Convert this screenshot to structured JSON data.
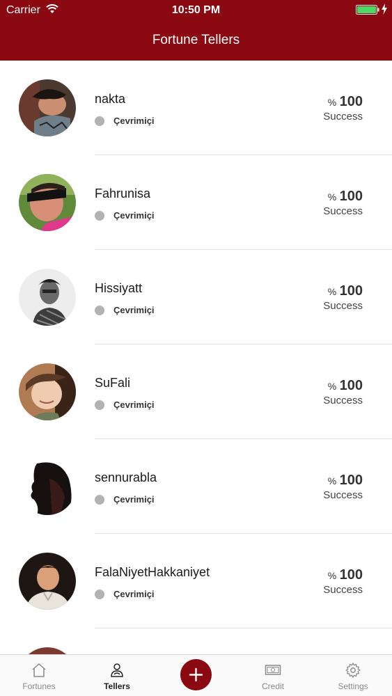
{
  "status_bar": {
    "carrier": "Carrier",
    "time": "10:50 PM",
    "battery_color": "#4cd964"
  },
  "header": {
    "title": "Fortune Tellers",
    "background": "#8b0911"
  },
  "tellers": [
    {
      "name": "nakta",
      "status": "Çevrimiçi",
      "percent_sign": "%",
      "percent": "100",
      "success_label": "Success"
    },
    {
      "name": "Fahrunisa",
      "status": "Çevrimiçi",
      "percent_sign": "%",
      "percent": "100",
      "success_label": "Success"
    },
    {
      "name": "Hissiyatt",
      "status": "Çevrimiçi",
      "percent_sign": "%",
      "percent": "100",
      "success_label": "Success"
    },
    {
      "name": "SuFali",
      "status": "Çevrimiçi",
      "percent_sign": "%",
      "percent": "100",
      "success_label": "Success"
    },
    {
      "name": "sennurabla",
      "status": "Çevrimiçi",
      "percent_sign": "%",
      "percent": "100",
      "success_label": "Success"
    },
    {
      "name": "FalaNiyetHakkaniyet",
      "status": "Çevrimiçi",
      "percent_sign": "%",
      "percent": "100",
      "success_label": "Success"
    }
  ],
  "tabbar": {
    "tabs": [
      {
        "label": "Fortunes",
        "icon": "home-icon",
        "active": false
      },
      {
        "label": "Tellers",
        "icon": "tellers-icon",
        "active": true
      },
      {
        "label": "Credit",
        "icon": "credit-icon",
        "active": false
      },
      {
        "label": "Settings",
        "icon": "gear-icon",
        "active": false
      }
    ],
    "add_button_icon": "plus-icon"
  }
}
